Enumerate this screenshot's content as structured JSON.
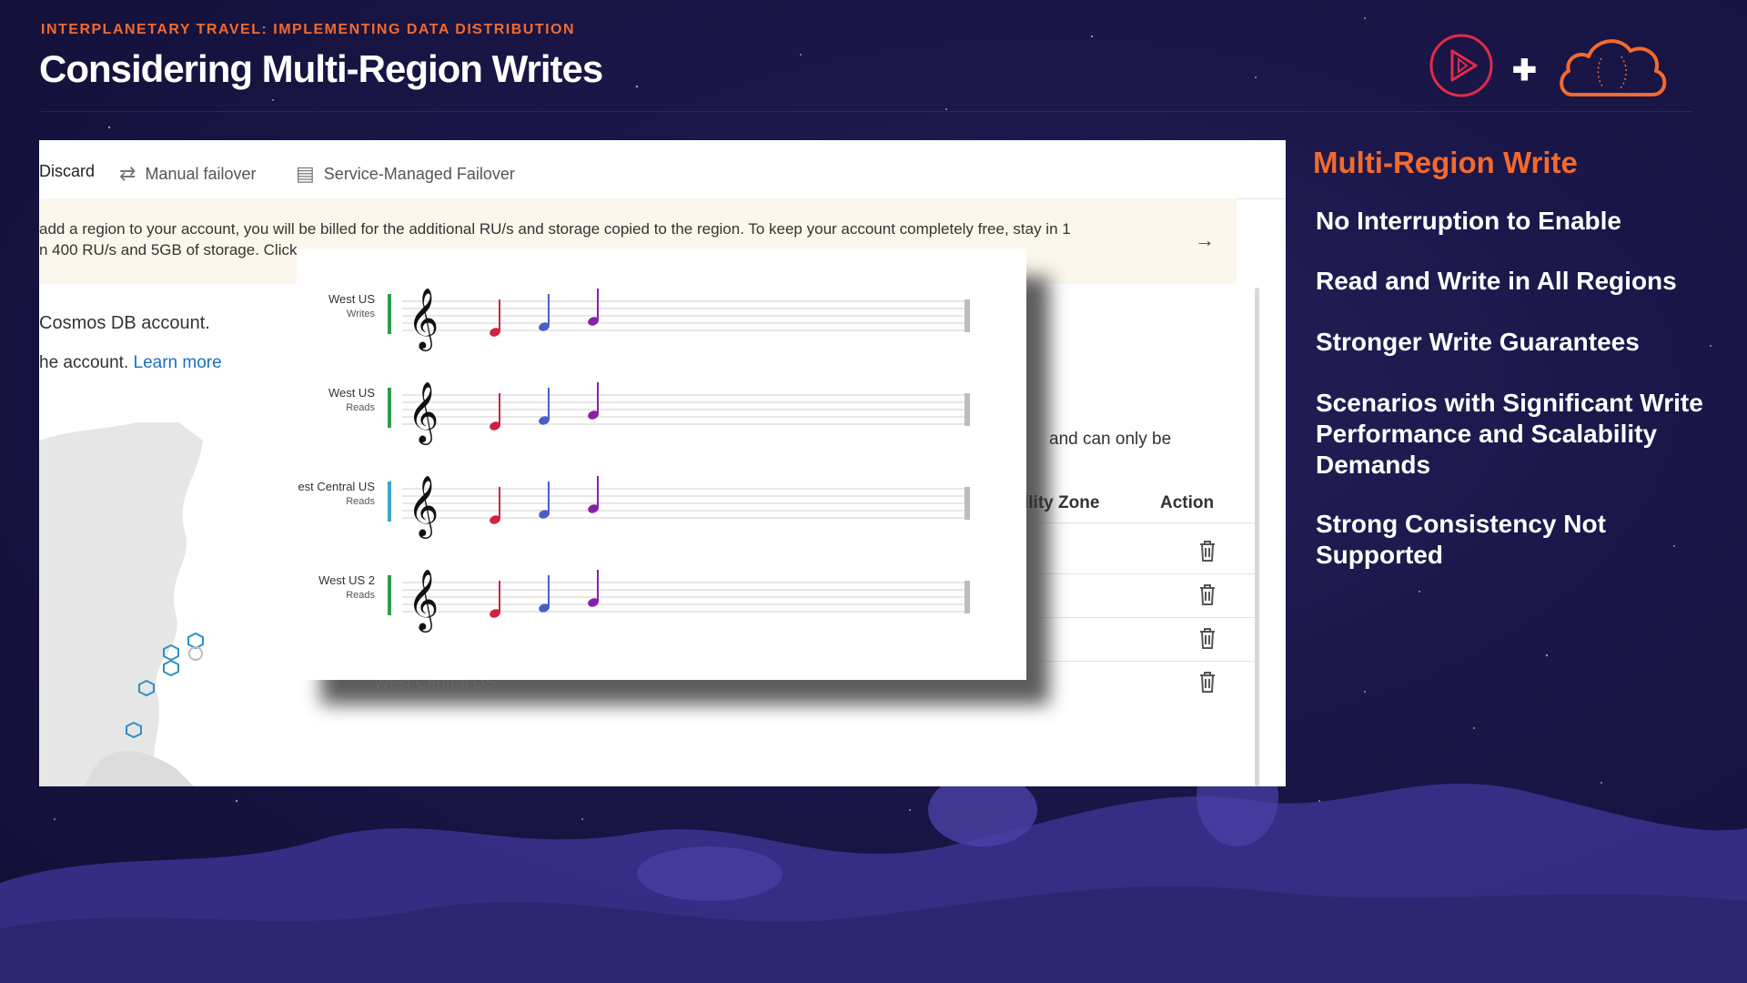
{
  "header": {
    "eyebrow": "INTERPLANETARY TRAVEL: IMPLEMENTING DATA DISTRIBUTION",
    "title": "Considering Multi-Region Writes"
  },
  "screenshot": {
    "toolbar": {
      "discard": "Discard",
      "manual_failover": "Manual failover",
      "service_managed_failover": "Service-Managed Failover"
    },
    "banner": {
      "line1": "add a region to your account, you will be billed for the additional RU/s and storage copied to the region. To keep your account completely free, stay in 1",
      "line2": "n 400 RU/s and 5GB of storage.   Click"
    },
    "desc1": "Cosmos DB account.",
    "desc2_prefix": "he account. ",
    "learn_more": "Learn more",
    "right_note": "and can only be",
    "columns": {
      "zone": "ility Zone",
      "action": "Action"
    },
    "behind_row": "West Central US"
  },
  "staffs": [
    {
      "region": "West US",
      "mode": "Writes"
    },
    {
      "region": "West US",
      "mode": "Reads"
    },
    {
      "region": "est Central US",
      "mode": "Reads"
    },
    {
      "region": "West US 2",
      "mode": "Reads"
    }
  ],
  "note_colors": [
    "#d0213f",
    "#4a5fc6",
    "#8a1fa8"
  ],
  "accent": "#f26a2e",
  "panel": {
    "heading": "Multi-Region Write",
    "items": [
      "No Interruption to Enable",
      "Read and Write in All Regions",
      "Stronger Write Guarantees",
      "Scenarios with Significant Write Performance and Scalability Demands",
      "Strong Consistency Not Supported"
    ]
  }
}
